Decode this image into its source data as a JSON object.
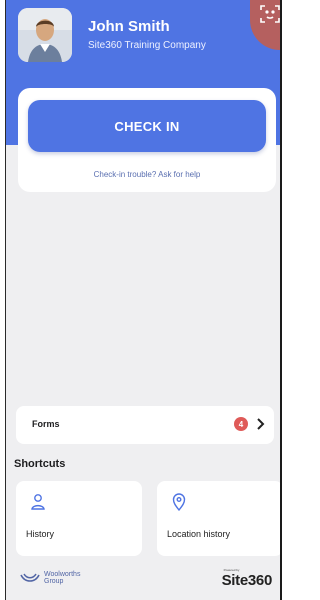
{
  "user": {
    "name": "John Smith",
    "company": "Site360 Training Company"
  },
  "checkin": {
    "button_label": "CHECK IN",
    "help_text": "Check-in trouble? Ask for help"
  },
  "forms": {
    "label": "Forms",
    "badge_count": "4"
  },
  "shortcuts": {
    "title": "Shortcuts",
    "items": [
      {
        "label": "History",
        "icon": "person-icon"
      },
      {
        "label": "Location history",
        "icon": "location-pin-icon"
      }
    ]
  },
  "footer": {
    "left_brand": "Woolworths",
    "left_brand_sub": "Group",
    "powered_by": "Powered by",
    "right_brand": "Site360"
  },
  "colors": {
    "primary": "#4f74e3",
    "badge": "#df5a58",
    "background": "#efeff1"
  }
}
